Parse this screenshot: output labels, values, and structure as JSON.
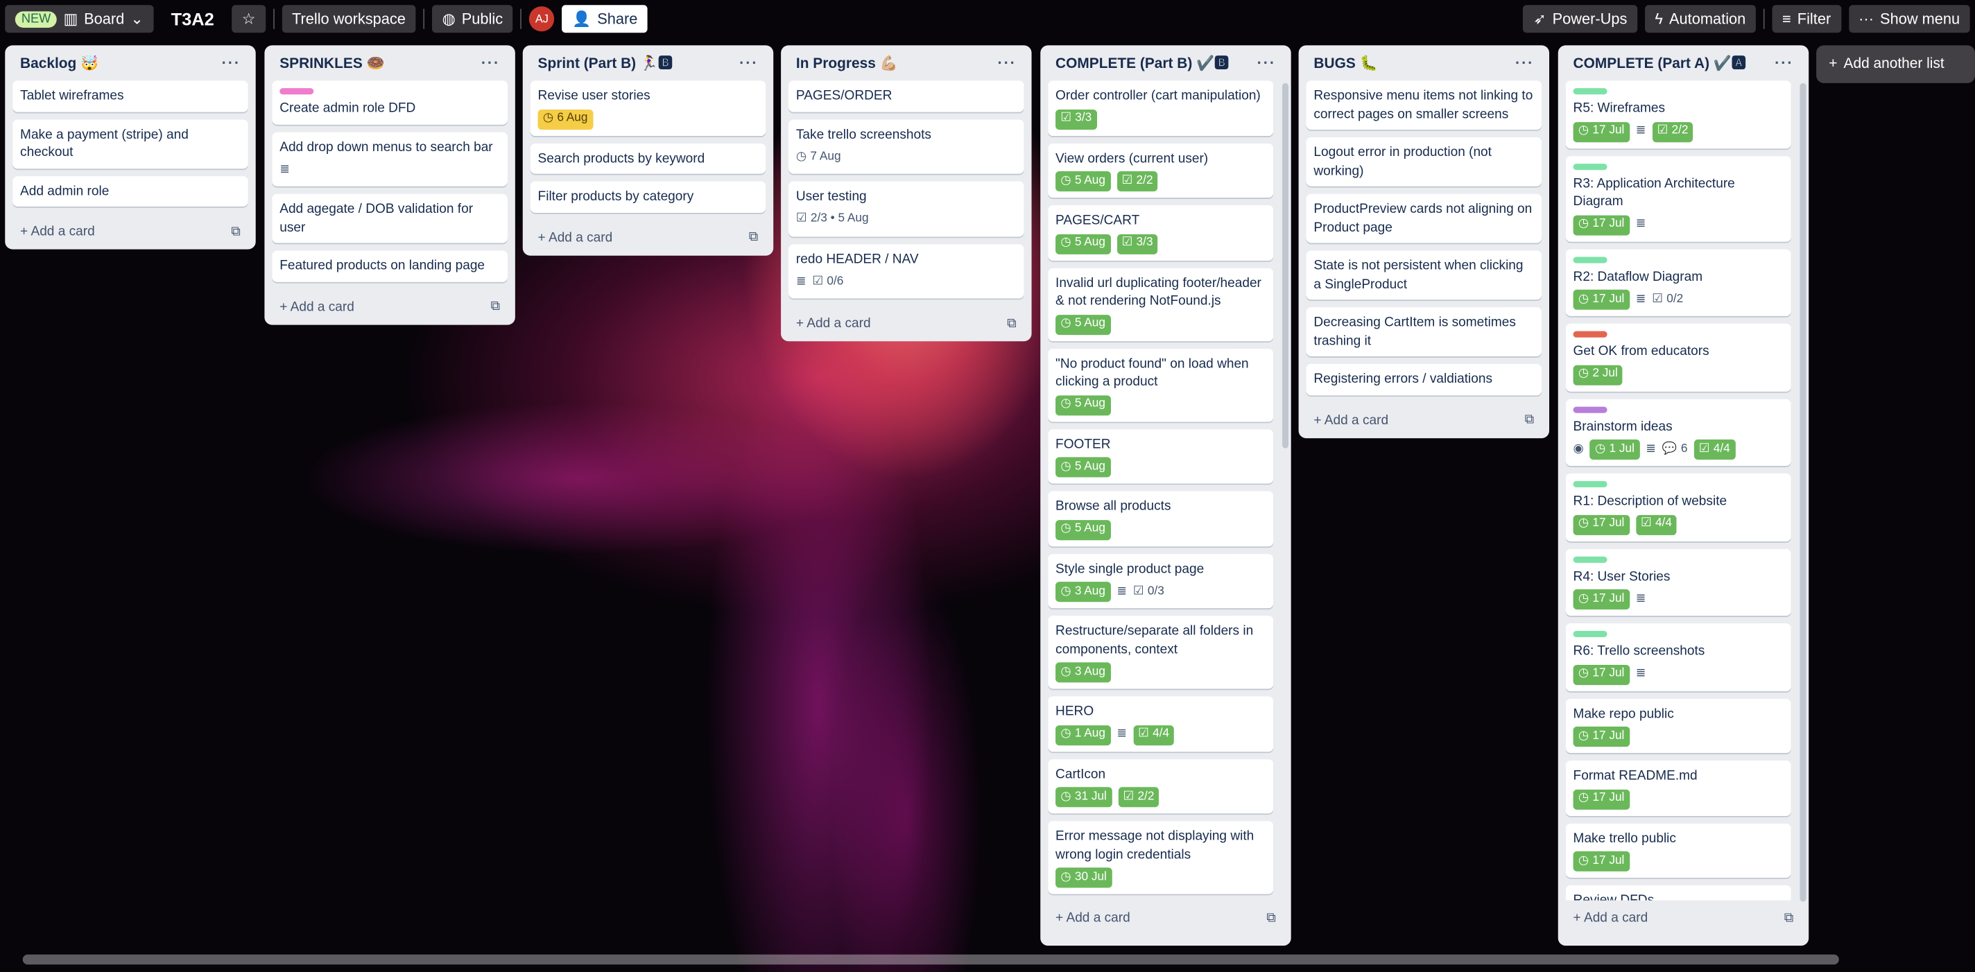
{
  "header": {
    "new_badge": "NEW",
    "view_label": "Board",
    "board_title": "T3A2",
    "workspace": "Trello workspace",
    "visibility": "Public",
    "avatar_initials": "AJ",
    "share": "Share",
    "power_ups": "Power-Ups",
    "automation": "Automation",
    "filter": "Filter",
    "show_menu": "Show menu"
  },
  "add_another_list": "Add another list",
  "add_card_label": "Add a card",
  "colors": {
    "complete": "#6ab85a",
    "due_soon": "#f5cd47",
    "label_green": "#7ee2a8",
    "label_red": "#e2654f",
    "label_purple": "#b77fdb",
    "label_pink": "#f07ccd"
  },
  "lists": [
    {
      "title": "Backlog 🤯",
      "cards": [
        {
          "title": "Tablet wireframes"
        },
        {
          "title": "Make a payment (stripe) and checkout"
        },
        {
          "title": "Add admin role"
        }
      ]
    },
    {
      "title": "SPRINKLES 🍩",
      "cards": [
        {
          "label": "pink",
          "title": "Create admin role DFD"
        },
        {
          "title": "Add drop down menus to search bar",
          "badges": [
            {
              "icon": "description-icon"
            }
          ]
        },
        {
          "title": "Add agegate / DOB validation for user"
        },
        {
          "title": "Featured products on landing page"
        }
      ]
    },
    {
      "title": "Sprint (Part B) 🏃‍♀️🅱",
      "cards": [
        {
          "title": "Revise user stories",
          "badges": [
            {
              "icon": "clock-icon",
              "text": "6 Aug",
              "state": "due-soon"
            }
          ]
        },
        {
          "title": "Search products by keyword"
        },
        {
          "title": "Filter products by category"
        }
      ]
    },
    {
      "title": "In Progress 💪🏼",
      "cards": [
        {
          "title": "PAGES/ORDER"
        },
        {
          "title": "Take trello screenshots",
          "badges": [
            {
              "icon": "clock-icon",
              "text": "7 Aug"
            }
          ]
        },
        {
          "title": "User testing",
          "badges": [
            {
              "icon": "checklist-icon",
              "text": "2/3 • 5 Aug"
            }
          ]
        },
        {
          "title": "redo HEADER / NAV",
          "badges": [
            {
              "icon": "description-icon"
            },
            {
              "icon": "checklist-icon",
              "text": "0/6"
            }
          ]
        }
      ]
    },
    {
      "title": "COMPLETE (Part B) ✔️🅱",
      "scroll": true,
      "cards": [
        {
          "title": "Order controller (cart manipulation)",
          "badges": [
            {
              "icon": "checklist-icon",
              "text": "3/3",
              "state": "complete"
            }
          ]
        },
        {
          "title": "View orders (current user)",
          "badges": [
            {
              "icon": "clock-icon",
              "text": "5 Aug",
              "state": "complete"
            },
            {
              "icon": "checklist-icon",
              "text": "2/2",
              "state": "complete"
            }
          ]
        },
        {
          "title": "PAGES/CART",
          "badges": [
            {
              "icon": "clock-icon",
              "text": "5 Aug",
              "state": "complete"
            },
            {
              "icon": "checklist-icon",
              "text": "3/3",
              "state": "complete"
            }
          ]
        },
        {
          "title": "Invalid url duplicating footer/header & not rendering NotFound.js",
          "badges": [
            {
              "icon": "clock-icon",
              "text": "5 Aug",
              "state": "complete"
            }
          ]
        },
        {
          "title": "\"No product found\" on load when clicking a product",
          "badges": [
            {
              "icon": "clock-icon",
              "text": "5 Aug",
              "state": "complete"
            }
          ]
        },
        {
          "title": "FOOTER",
          "badges": [
            {
              "icon": "clock-icon",
              "text": "5 Aug",
              "state": "complete"
            }
          ]
        },
        {
          "title": "Browse all products",
          "badges": [
            {
              "icon": "clock-icon",
              "text": "5 Aug",
              "state": "complete"
            }
          ]
        },
        {
          "title": "Style single product page",
          "badges": [
            {
              "icon": "clock-icon",
              "text": "3 Aug",
              "state": "complete"
            },
            {
              "icon": "description-icon"
            },
            {
              "icon": "checklist-icon",
              "text": "0/3"
            }
          ]
        },
        {
          "title": "Restructure/separate all folders in components, context",
          "badges": [
            {
              "icon": "clock-icon",
              "text": "3 Aug",
              "state": "complete"
            }
          ]
        },
        {
          "title": "HERO",
          "badges": [
            {
              "icon": "clock-icon",
              "text": "1 Aug",
              "state": "complete"
            },
            {
              "icon": "description-icon"
            },
            {
              "icon": "checklist-icon",
              "text": "4/4",
              "state": "complete"
            }
          ]
        },
        {
          "title": "CartIcon",
          "badges": [
            {
              "icon": "clock-icon",
              "text": "31 Jul",
              "state": "complete"
            },
            {
              "icon": "checklist-icon",
              "text": "2/2",
              "state": "complete"
            }
          ]
        },
        {
          "title": "Error message not displaying with wrong login credentials",
          "badges": [
            {
              "icon": "clock-icon",
              "text": "30 Jul",
              "state": "complete"
            }
          ]
        }
      ]
    },
    {
      "title": "BUGS 🐛",
      "cards": [
        {
          "title": "Responsive menu items not linking to correct pages on smaller screens"
        },
        {
          "title": "Logout error in production (not working)"
        },
        {
          "title": "ProductPreview cards not aligning on Product page"
        },
        {
          "title": "State is not persistent when clicking a SingleProduct"
        },
        {
          "title": "Decreasing CartItem is sometimes trashing it"
        },
        {
          "title": "Registering errors / valdiations"
        }
      ]
    },
    {
      "title": "COMPLETE (Part A) ✔️🅰",
      "scroll": true,
      "cards": [
        {
          "label": "green",
          "title": "R5: Wireframes",
          "badges": [
            {
              "icon": "clock-icon",
              "text": "17 Jul",
              "state": "complete"
            },
            {
              "icon": "description-icon"
            },
            {
              "icon": "checklist-icon",
              "text": "2/2",
              "state": "complete"
            }
          ]
        },
        {
          "label": "green",
          "title": "R3: Application Architecture Diagram",
          "badges": [
            {
              "icon": "clock-icon",
              "text": "17 Jul",
              "state": "complete"
            },
            {
              "icon": "description-icon"
            }
          ]
        },
        {
          "label": "green",
          "title": "R2: Dataflow Diagram",
          "badges": [
            {
              "icon": "clock-icon",
              "text": "17 Jul",
              "state": "complete"
            },
            {
              "icon": "description-icon"
            },
            {
              "icon": "checklist-icon",
              "text": "0/2"
            }
          ]
        },
        {
          "label": "red",
          "title": "Get OK from educators",
          "badges": [
            {
              "icon": "clock-icon",
              "text": "2 Jul",
              "state": "complete"
            }
          ]
        },
        {
          "label": "purple",
          "title": "Brainstorm ideas",
          "badges": [
            {
              "icon": "eye-icon"
            },
            {
              "icon": "clock-icon",
              "text": "1 Jul",
              "state": "complete"
            },
            {
              "icon": "description-icon"
            },
            {
              "icon": "comment-icon",
              "text": "6"
            },
            {
              "icon": "checklist-icon",
              "text": "4/4",
              "state": "complete"
            }
          ]
        },
        {
          "label": "green",
          "title": "R1: Description of website",
          "badges": [
            {
              "icon": "clock-icon",
              "text": "17 Jul",
              "state": "complete"
            },
            {
              "icon": "checklist-icon",
              "text": "4/4",
              "state": "complete"
            }
          ]
        },
        {
          "label": "green",
          "title": "R4: User Stories",
          "badges": [
            {
              "icon": "clock-icon",
              "text": "17 Jul",
              "state": "complete"
            },
            {
              "icon": "description-icon"
            }
          ]
        },
        {
          "label": "green",
          "title": "R6: Trello screenshots",
          "badges": [
            {
              "icon": "clock-icon",
              "text": "17 Jul",
              "state": "complete"
            },
            {
              "icon": "description-icon"
            }
          ]
        },
        {
          "title": "Make repo public",
          "badges": [
            {
              "icon": "clock-icon",
              "text": "17 Jul",
              "state": "complete"
            }
          ]
        },
        {
          "title": "Format README.md",
          "badges": [
            {
              "icon": "clock-icon",
              "text": "17 Jul",
              "state": "complete"
            }
          ]
        },
        {
          "title": "Make trello public",
          "badges": [
            {
              "icon": "clock-icon",
              "text": "17 Jul",
              "state": "complete"
            }
          ]
        },
        {
          "title": "Review DFDs"
        }
      ]
    }
  ]
}
